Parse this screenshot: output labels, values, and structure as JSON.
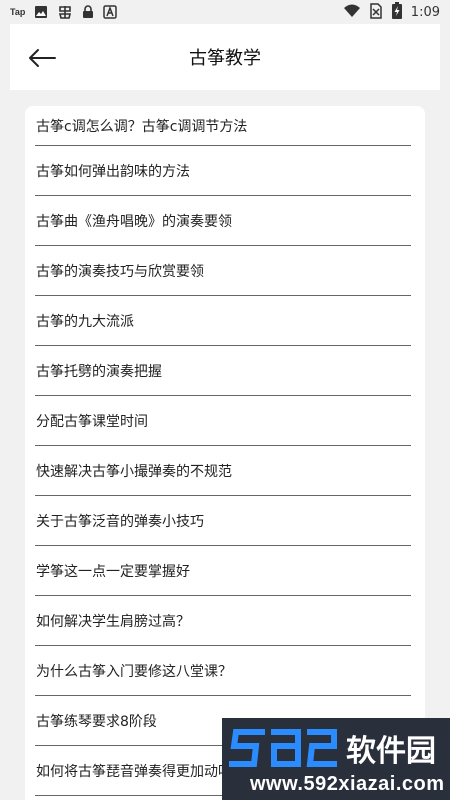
{
  "status_bar": {
    "time": "1:09",
    "left_icons": [
      "tap-icon",
      "image-icon",
      "bug-icon",
      "lock-icon",
      "a-icon"
    ],
    "tap_label": "Tap",
    "right_icons": [
      "wifi-icon",
      "no-sim-icon",
      "battery-charging-icon"
    ]
  },
  "header": {
    "title": "古筝教学",
    "back_icon": "arrow-left-icon"
  },
  "list": {
    "items": [
      "古筝c调怎么调？古筝c调调节方法",
      "古筝如何弹出韵味的方法",
      "古筝曲《渔舟唱晚》的演奏要领",
      "古筝的演奏技巧与欣赏要领",
      "古筝的九大流派",
      "古筝托劈的演奏把握",
      "分配古筝课堂时间",
      "快速解决古筝小撮弹奏的不规范",
      "关于古筝泛音的弹奏小技巧",
      "学筝这一点一定要掌握好",
      "如何解决学生肩膀过高？",
      "为什么古筝入门要修这八堂课？",
      "古筝练琴要求8阶段",
      "如何将古筝琵音弹奏得更加动听"
    ]
  },
  "watermark": {
    "logo_text": "592软件园",
    "url": "www.592xiazai.com"
  },
  "colors": {
    "background": "#f1f1f1",
    "card": "#ffffff",
    "divider": "#666666",
    "watermark_bg": "#2a2f3c",
    "watermark_accent": "#2b8cff"
  }
}
